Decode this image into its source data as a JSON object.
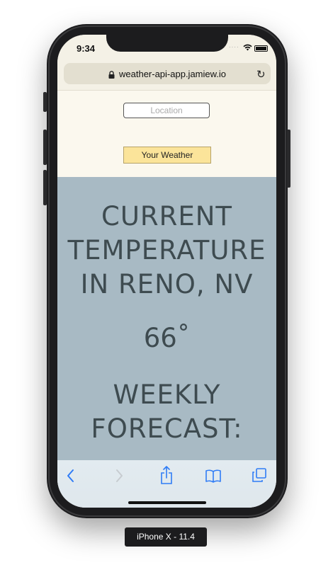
{
  "status": {
    "time": "9:34"
  },
  "browser": {
    "url": "weather-api-app.jamiew.io"
  },
  "form": {
    "location_placeholder": "Location",
    "button_label": "Your Weather"
  },
  "weather": {
    "heading_lines": [
      "CURRENT",
      "TEMPERATURE",
      "IN RENO, NV"
    ],
    "temperature": "66˚",
    "forecast_lines": [
      "WEEKLY",
      "FORECAST:"
    ]
  },
  "toolbar": {
    "icons": [
      "back-icon",
      "forward-icon",
      "share-icon",
      "bookmarks-icon",
      "tabs-icon"
    ]
  },
  "device": {
    "label": "iPhone X - 11.4"
  },
  "colors": {
    "panel": "#a8bac4",
    "button": "#fbe49a",
    "page": "#fbf8ee",
    "text": "#3e4b50"
  }
}
